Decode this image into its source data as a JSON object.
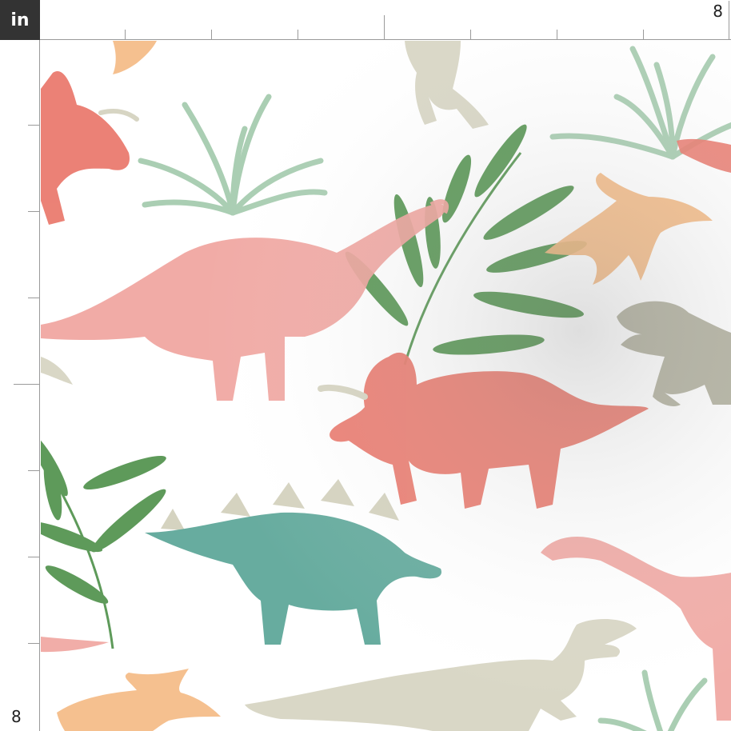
{
  "ruler": {
    "unit_label": "in",
    "top_end_label": "8",
    "left_end_label": "8"
  },
  "fabric": {
    "motifs": [
      "brachiosaurus-icon",
      "triceratops-icon",
      "stegosaurus-icon",
      "t-rex-icon",
      "pterodactyl-icon",
      "palm-leaf-icon",
      "grass-plant-icon"
    ],
    "colors": {
      "pink": "#f0a49e",
      "coral": "#ea7b6f",
      "teal": "#5fa89a",
      "sand": "#d5d3c0",
      "grey": "#a9a894",
      "peach": "#f4b983",
      "leaf": "#5e9a5a",
      "leaf_light": "#9cc6a6"
    }
  }
}
